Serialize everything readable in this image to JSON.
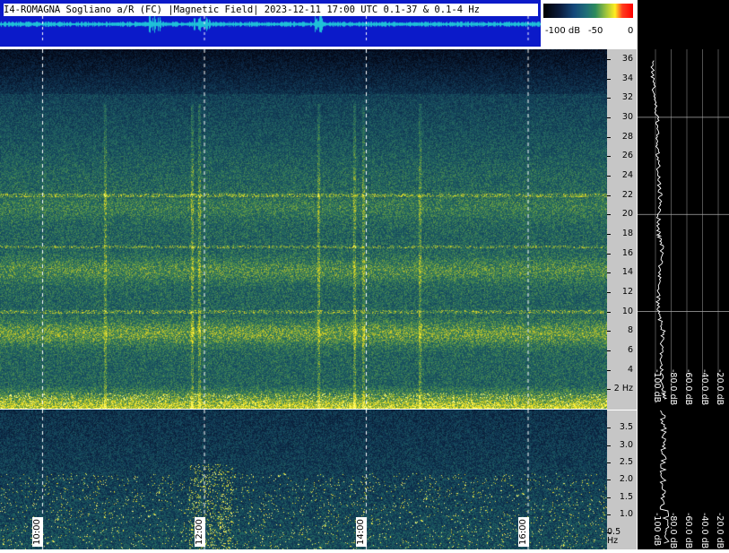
{
  "title": "I4-ROMAGNA  Sogliano a/R (FC) |Magnetic Field| 2023-12-11 17:00 UTC 0.1-37 & 0.1-4 Hz",
  "colorbar": {
    "labels": [
      "-100 dB",
      "-50",
      "0"
    ]
  },
  "chart_data": [
    {
      "type": "heatmap",
      "title": "",
      "xlabel": "",
      "ylabel": "",
      "x_ticks": [
        "10:00",
        "12:00",
        "14:00",
        "16:00"
      ],
      "y_ticks": [
        "2 Hz",
        "4",
        "6",
        "8",
        "10",
        "12",
        "14",
        "16",
        "18",
        "20",
        "22",
        "24",
        "26",
        "28",
        "30",
        "32",
        "34",
        "36"
      ],
      "ylim": [
        0,
        37
      ],
      "color_scale": {
        "min_db": -100,
        "max_db": 0
      },
      "line_features_hz": [
        16.7,
        22.0,
        10.0
      ],
      "band_features_hz": [
        {
          "center": 7.8,
          "level": 0.75
        },
        {
          "center": 14.3,
          "level": 0.55
        },
        {
          "center": 20.8,
          "level": 0.35
        }
      ]
    },
    {
      "type": "heatmap",
      "title": "",
      "xlabel": "",
      "ylabel": "",
      "x_ticks": [
        "10:00",
        "12:00",
        "14:00",
        "16:00"
      ],
      "y_ticks": [
        "0.5 Hz",
        "1.0",
        "1.5",
        "2.0",
        "2.5",
        "3.0",
        "3.5"
      ],
      "ylim": [
        0.1,
        4.0
      ]
    },
    {
      "type": "line",
      "title": "",
      "x_ticks": [
        "-100 dB",
        "-80.0 dB",
        "-60.0 dB",
        "-40.0 dB",
        "-20.0 dB"
      ],
      "profile": [
        {
          "hz": 1,
          "db": -88
        },
        {
          "hz": 2,
          "db": -90
        },
        {
          "hz": 4,
          "db": -92
        },
        {
          "hz": 6,
          "db": -93
        },
        {
          "hz": 8,
          "db": -90
        },
        {
          "hz": 10,
          "db": -97
        },
        {
          "hz": 12,
          "db": -96
        },
        {
          "hz": 14,
          "db": -95
        },
        {
          "hz": 16.7,
          "db": -91
        },
        {
          "hz": 18,
          "db": -96
        },
        {
          "hz": 20,
          "db": -96
        },
        {
          "hz": 22,
          "db": -94
        },
        {
          "hz": 24,
          "db": -96
        },
        {
          "hz": 26,
          "db": -97
        },
        {
          "hz": 28,
          "db": -97
        },
        {
          "hz": 30,
          "db": -98
        },
        {
          "hz": 32,
          "db": -102
        },
        {
          "hz": 34,
          "db": -103
        },
        {
          "hz": 36,
          "db": -104
        }
      ]
    }
  ]
}
